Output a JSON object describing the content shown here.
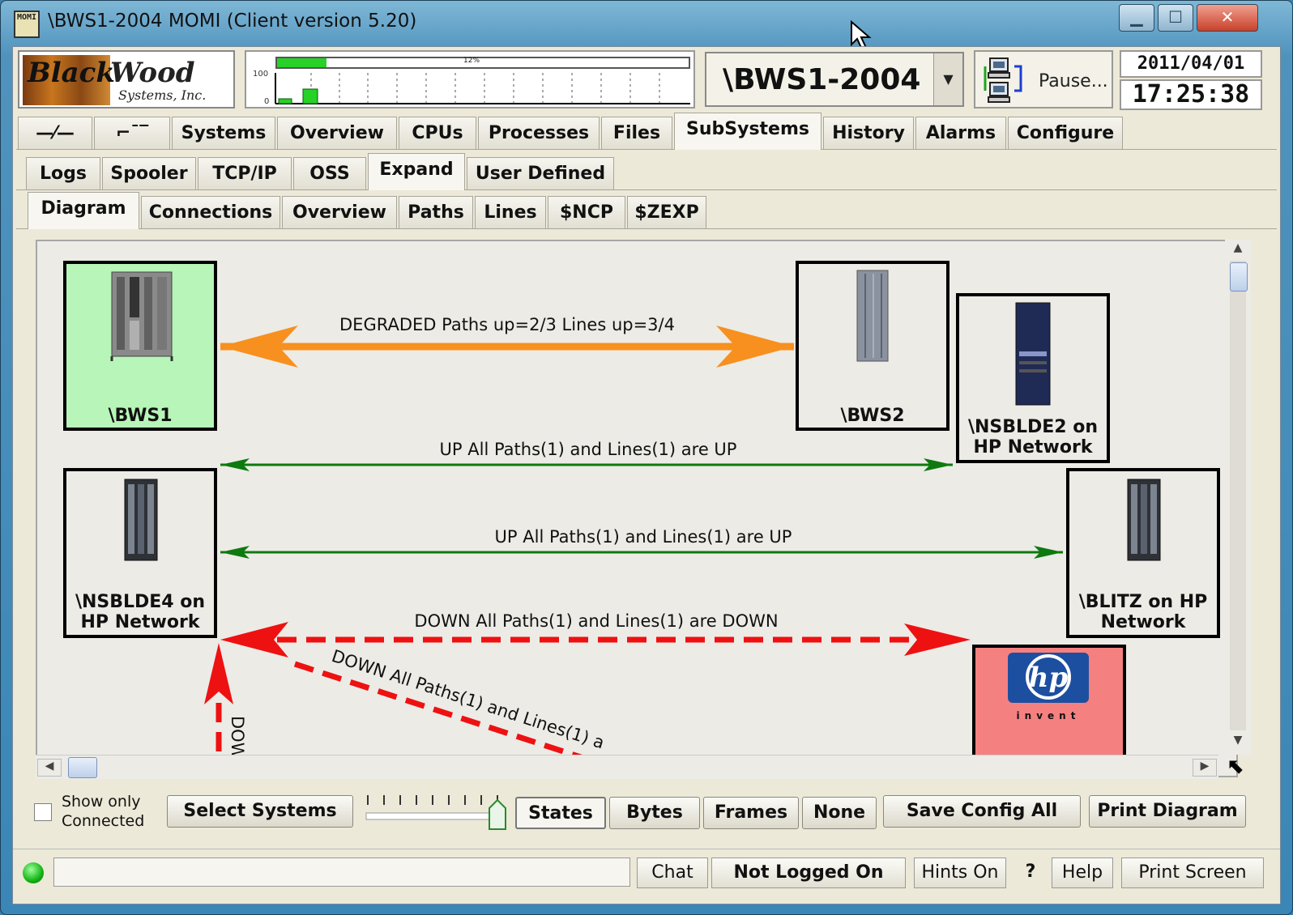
{
  "window": {
    "title": "\\BWS1-2004 MOMI (Client version 5.20)",
    "app_icon_text": "MOMI",
    "minimize": "▁",
    "maximize": "☐",
    "close": "✕"
  },
  "header": {
    "logo_black": "Black",
    "logo_wood": "Wood",
    "logo_sub": "Systems, Inc.",
    "cpu_percent_label": "12%",
    "cpu_percent": 12,
    "graph_y_max": "100",
    "graph_y_min": "0",
    "system_name": "\\BWS1-2004",
    "pause_label": "Pause...",
    "date": "2011/04/01",
    "time": "17:25:38"
  },
  "main_tabs": [
    {
      "label": "—⁄—"
    },
    {
      "label": "⌐¯‾"
    },
    {
      "label": "Systems"
    },
    {
      "label": "Overview"
    },
    {
      "label": "CPUs"
    },
    {
      "label": "Processes"
    },
    {
      "label": "Files"
    },
    {
      "label": "SubSystems",
      "active": true
    },
    {
      "label": "History"
    },
    {
      "label": "Alarms"
    },
    {
      "label": "Configure"
    }
  ],
  "sub_tabs": [
    {
      "label": "Logs"
    },
    {
      "label": "Spooler"
    },
    {
      "label": "TCP/IP"
    },
    {
      "label": "OSS"
    },
    {
      "label": "Expand",
      "active": true
    },
    {
      "label": "User Defined"
    }
  ],
  "expand_tabs": [
    {
      "label": "Diagram",
      "active": true
    },
    {
      "label": "Connections"
    },
    {
      "label": "Overview"
    },
    {
      "label": "Paths"
    },
    {
      "label": "Lines"
    },
    {
      "label": "$NCP"
    },
    {
      "label": "$ZEXP"
    }
  ],
  "diagram": {
    "nodes": [
      {
        "label": "\\BWS1"
      },
      {
        "label": "\\BWS2"
      },
      {
        "label": "\\NSBLDE2 on HP Network"
      },
      {
        "label": "\\NSBLDE4 on HP Network"
      },
      {
        "label": "\\BLITZ on HP Network"
      },
      {
        "label": "invent"
      }
    ],
    "links": [
      {
        "label": "DEGRADED Paths up=2/3 Lines up=3/4",
        "state": "degraded"
      },
      {
        "label": "UP All Paths(1) and Lines(1) are UP",
        "state": "up"
      },
      {
        "label": "UP All Paths(1) and Lines(1) are UP",
        "state": "up"
      },
      {
        "label": "DOWN All Paths(1) and Lines(1) are DOWN",
        "state": "down"
      },
      {
        "label": "DOWN All Paths(1) and Lines(1) a",
        "state": "down"
      },
      {
        "label": "DOW",
        "state": "down"
      }
    ],
    "colors": {
      "degraded": "#f7901e",
      "up": "#0e7a0e",
      "down": "#ee1111",
      "bws1_bg": "#b8f5b8",
      "hp_bg": "#f58080"
    }
  },
  "bottom": {
    "show_only_line1": "Show only",
    "show_only_line2": "Connected",
    "select_systems": "Select Systems",
    "seg_states": "States",
    "seg_bytes": "Bytes",
    "seg_frames": "Frames",
    "seg_none": "None",
    "save_config": "Save Config All",
    "print_diagram": "Print Diagram"
  },
  "status": {
    "chat": "Chat",
    "login": "Not Logged On",
    "hints": "Hints On",
    "question": "?",
    "help": "Help",
    "print_screen": "Print Screen"
  }
}
